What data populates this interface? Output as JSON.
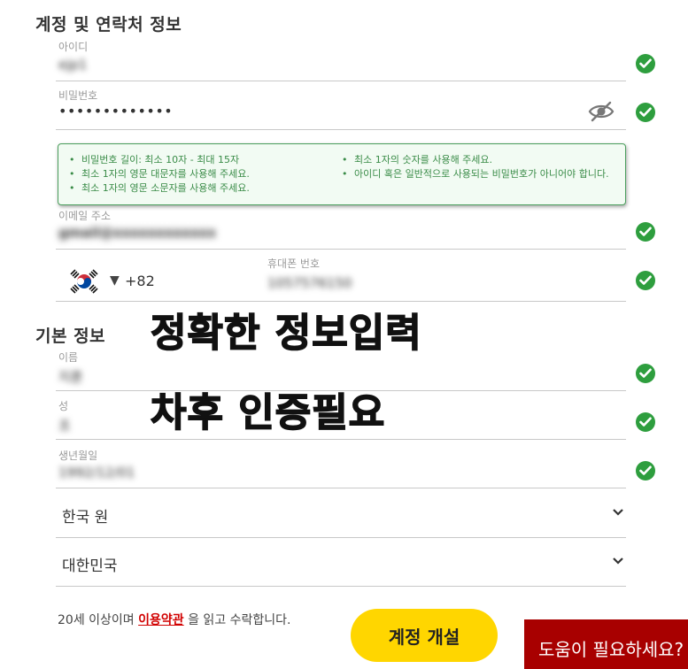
{
  "account_section": {
    "title": "계정 및 연락처 정보",
    "username": {
      "label": "아이디",
      "value": "ejp1"
    },
    "password": {
      "label": "비밀번호",
      "value": "•••••••••••••",
      "rules_left": [
        "비밀번호 길이: 최소 10자 - 최대 15자",
        "최소 1자의 영문 대문자를 사용해 주세요.",
        "최소 1자의 영문 소문자를 사용해 주세요."
      ],
      "rules_right": [
        "최소 1자의 숫자를 사용해 주세요.",
        "아이디 혹은 일반적으로 사용되는 비밀번호가 아니어야 합니다."
      ]
    },
    "email": {
      "label": "이메일 주소",
      "value": "gmail@xxxxxxxxxxxx"
    },
    "phone": {
      "country_code": "+82",
      "label": "휴대폰 번호",
      "value": "1057576150"
    }
  },
  "basic_section": {
    "title": "기본 정보",
    "first_name": {
      "label": "이름",
      "value": "지훈"
    },
    "last_name": {
      "label": "성",
      "value": "조"
    },
    "birthdate": {
      "label": "생년월일",
      "value": "1992/12/01"
    },
    "currency": {
      "value": "한국 원"
    },
    "country": {
      "value": "대한민국"
    }
  },
  "overlay": {
    "line1": "정확한 정보입력",
    "line2": "차후 인증필요"
  },
  "terms": {
    "prefix": "20세 이상이며 ",
    "link": "이용약관",
    "suffix": " 을 읽고 수락합니다."
  },
  "submit_label": "계정 개설",
  "help_label": "도움이 필요하세요?",
  "colors": {
    "valid_check": "#2e9e3e",
    "rules_text": "#3a8c48",
    "submit_bg": "#ffd600",
    "help_bg": "#a80000",
    "link": "#d10000"
  },
  "icons": {
    "valid": "check-circle-icon",
    "password_visibility": "eye-slash-icon",
    "country_flag": "south-korea-flag-icon",
    "dropdown": "chevron-down-icon"
  }
}
